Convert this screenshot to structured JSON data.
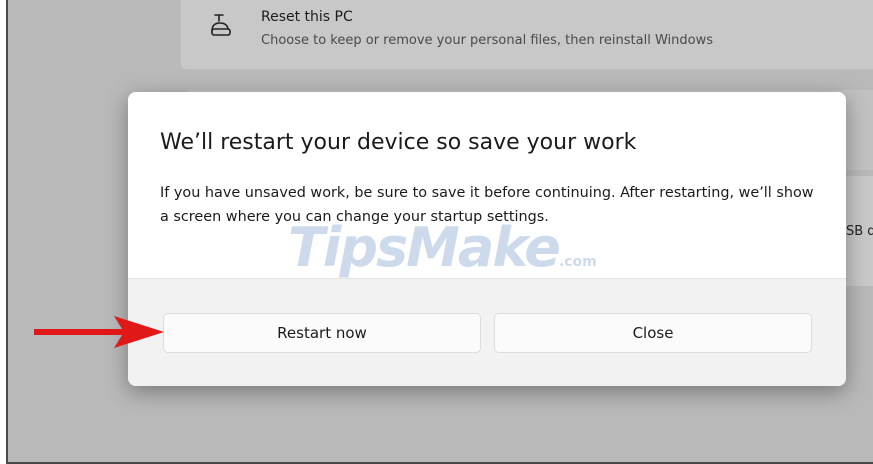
{
  "background": {
    "reset_card": {
      "title": "Reset this PC",
      "subtitle": "Choose to keep or remove your personal files, then reinstall Windows",
      "icon": "reset-pc-icon"
    },
    "snippet": "SB d"
  },
  "dialog": {
    "title": "We’ll restart your device so save your work",
    "message": "If you have unsaved work, be sure to save it before continuing. After restarting, we’ll show a screen where you can change your startup settings.",
    "buttons": {
      "restart_label": "Restart now",
      "close_label": "Close"
    }
  },
  "watermark": {
    "main": "TipsMake",
    "suffix": ".com"
  },
  "annotation": {
    "arrow_color": "#e01818",
    "icon": "red-arrow-icon"
  }
}
